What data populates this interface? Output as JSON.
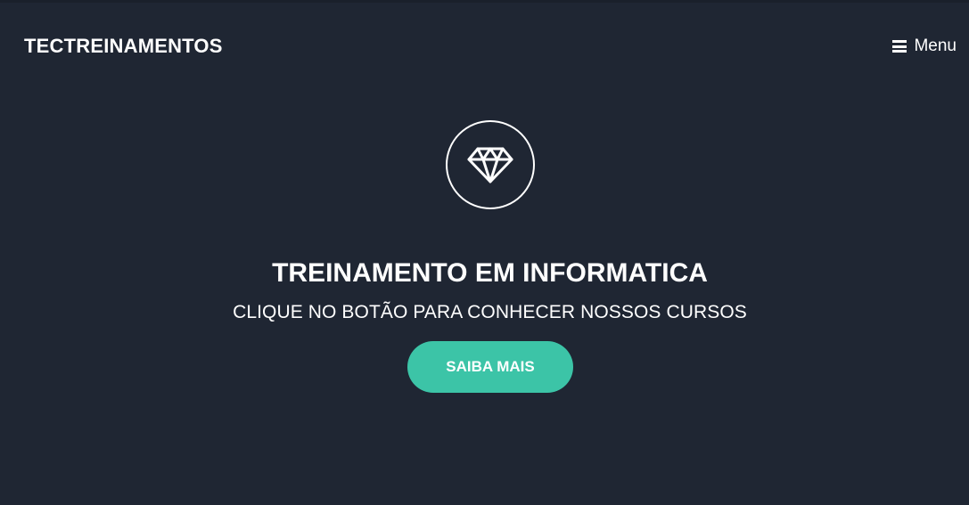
{
  "navbar": {
    "brand": "TECTREINAMENTOS",
    "menu_icon": "hamburger-icon",
    "menu_label": "Menu"
  },
  "hero": {
    "icon": "diamond-icon",
    "title": "TREINAMENTO EM INFORMATICA",
    "subtitle": "CLIQUE NO BOTÃO PARA CONHECER NOSSOS CURSOS",
    "cta_label": "SAIBA MAIS"
  },
  "colors": {
    "background": "#1f2633",
    "accent": "#3cc4a7",
    "text": "#ffffff"
  }
}
